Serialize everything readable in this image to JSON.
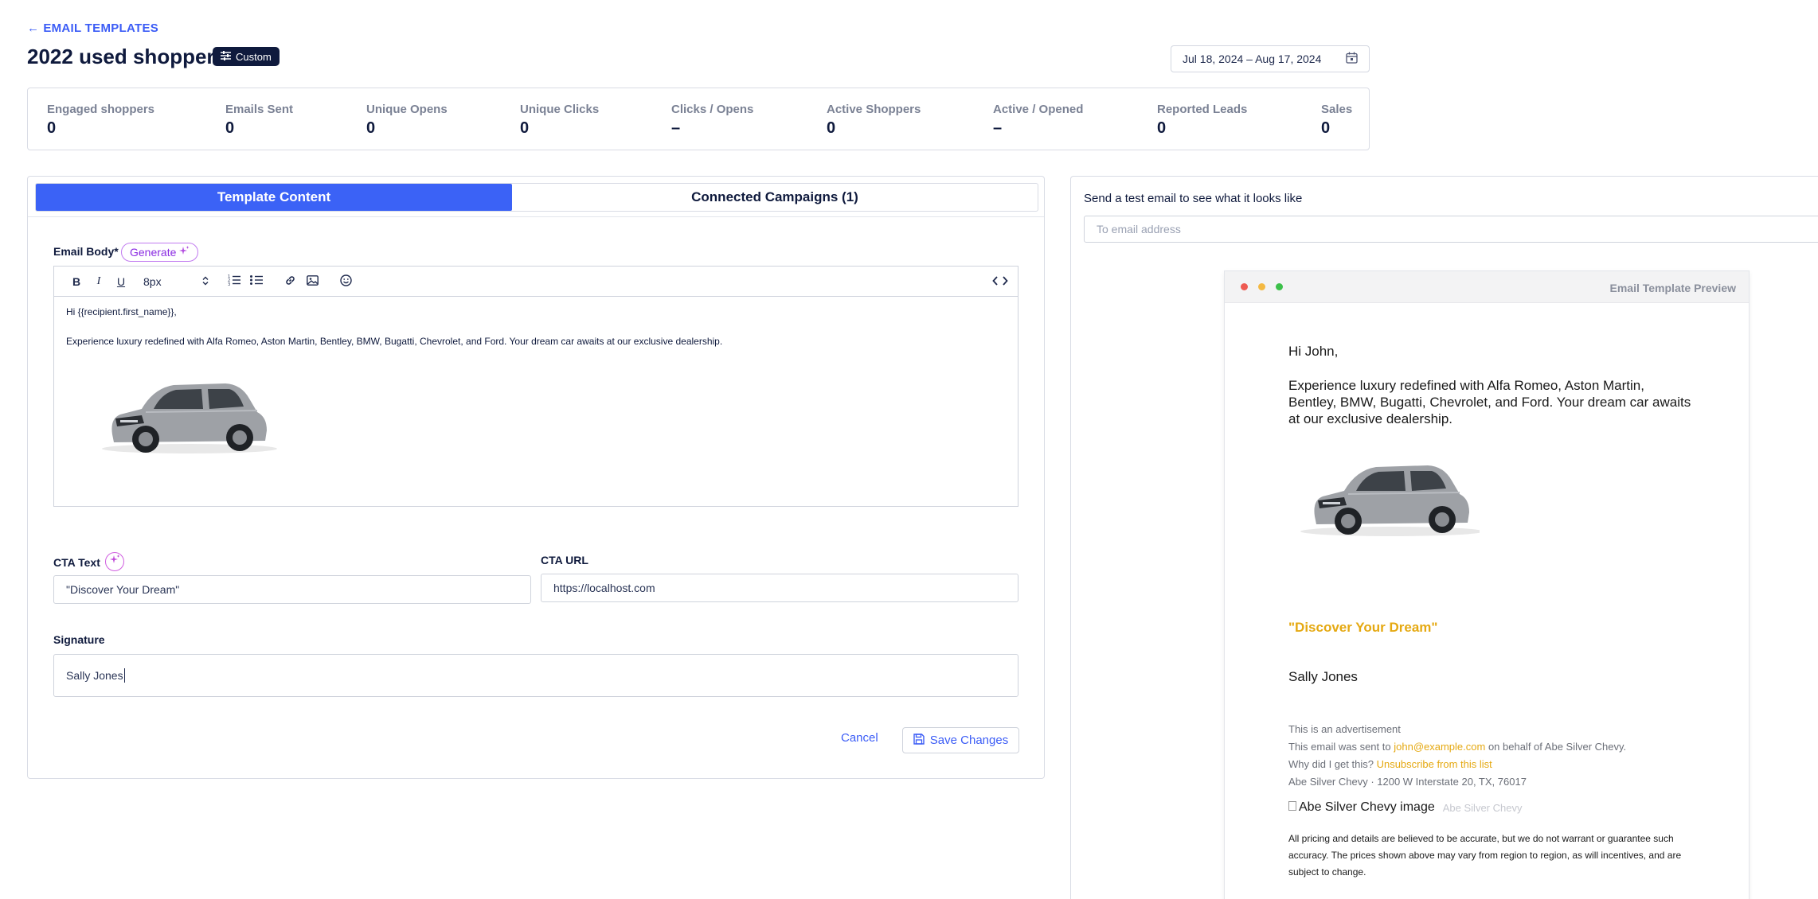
{
  "header": {
    "back_label": "EMAIL TEMPLATES",
    "title": "2022 used shoppers",
    "badge_label": "Custom",
    "date_range": "Jul 18, 2024 – Aug 17, 2024"
  },
  "stats": [
    {
      "label": "Engaged shoppers",
      "value": "0"
    },
    {
      "label": "Emails Sent",
      "value": "0"
    },
    {
      "label": "Unique Opens",
      "value": "0"
    },
    {
      "label": "Unique Clicks",
      "value": "0"
    },
    {
      "label": "Clicks / Opens",
      "value": "–"
    },
    {
      "label": "Active Shoppers",
      "value": "0"
    },
    {
      "label": "Active / Opened",
      "value": "–"
    },
    {
      "label": "Reported Leads",
      "value": "0"
    },
    {
      "label": "Sales",
      "value": "0"
    }
  ],
  "tabs": [
    {
      "label": "Template Content",
      "active": true
    },
    {
      "label": "Connected Campaigns (1)",
      "active": false
    }
  ],
  "editor": {
    "email_body_label": "Email Body*",
    "generate_label": "Generate",
    "font_size": "8px",
    "body_greeting": "Hi {{recipient.first_name}},",
    "body_text": "Experience luxury redefined with Alfa Romeo, Aston Martin, Bentley, BMW, Bugatti, Chevrolet, and Ford. Your dream car awaits at our exclusive dealership.",
    "cta_text_label": "CTA Text",
    "cta_text_value": "\"Discover Your Dream\"",
    "cta_url_label": "CTA URL",
    "cta_url_value": "https://localhost.com",
    "signature_label": "Signature",
    "signature_value": "Sally Jones",
    "cancel_label": "Cancel",
    "save_label": "Save Changes"
  },
  "test_email": {
    "label": "Send a test email to see what it looks like",
    "placeholder": "To email address"
  },
  "preview": {
    "title": "Email Template Preview",
    "greeting": "Hi John,",
    "body": "Experience luxury redefined with Alfa Romeo, Aston Martin, Bentley, BMW, Bugatti, Chevrolet, and Ford. Your dream car awaits at our ex­clusive dealership.",
    "cta": "\"Discover Your Dream\"",
    "signature": "Sally Jones",
    "footer_ad": "This is an advertisement",
    "footer_sent_prefix": "This email was sent to",
    "footer_email": "john@example.com",
    "footer_sent_suffix": "on behalf of Abe Silver Chevy.",
    "footer_why": "Why did I get this?",
    "footer_unsubscribe": "Unsubscribe from this list",
    "footer_address": "Abe Silver Chevy · 1200 W Interstate 20, TX, 76017",
    "logo_alt": "Abe Silver Chevy image",
    "logo_name": "Abe Silver Chevy",
    "disclaimer": "All pricing and details are believed to be accurate, but we do not warrant or guarantee such accuracy. The prices shown above may vary from region to region, as will incentives, and are subject to change."
  },
  "colors": {
    "accent": "#3b62f6",
    "navy": "#0f1a3d",
    "cta_gold": "#e5a912",
    "ai_purple": "#8a2be2"
  }
}
